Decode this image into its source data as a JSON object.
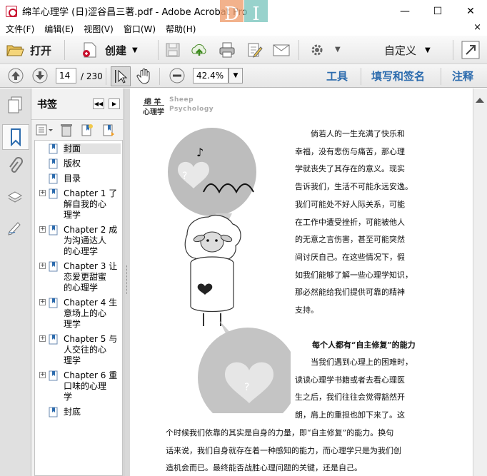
{
  "window": {
    "title": "绵羊心理学 (日)涩谷昌三著.pdf - Adobe Acrobat Pro",
    "logo_letters": [
      "D",
      "I"
    ],
    "controls": {
      "minimize": "—",
      "maximize": "☐",
      "close": "✕"
    }
  },
  "menu": {
    "items": [
      "文件(F)",
      "编辑(E)",
      "视图(V)",
      "窗口(W)",
      "帮助(H)"
    ],
    "close_doc": "×"
  },
  "toolbar": {
    "open_label": "打开",
    "create_label": "创建",
    "customize_label": "自定义"
  },
  "nav": {
    "current_page": "14",
    "page_total": "/ 230",
    "zoom": "42.4%",
    "tools_label": "工具",
    "fill_sign_label": "填写和签名",
    "comment_label": "注释"
  },
  "bookmarks": {
    "title": "书签",
    "items": [
      {
        "lines": [
          "封面"
        ],
        "expandable": false,
        "selected": true
      },
      {
        "lines": [
          "版权"
        ],
        "expandable": false,
        "selected": false
      },
      {
        "lines": [
          "目录"
        ],
        "expandable": false,
        "selected": false
      },
      {
        "lines": [
          "Chapter 1 了",
          "解自我的心",
          "理学"
        ],
        "expandable": true,
        "selected": false
      },
      {
        "lines": [
          "Chapter 2 成",
          "为沟通达人",
          "的心理学"
        ],
        "expandable": true,
        "selected": false
      },
      {
        "lines": [
          "Chapter 3 让",
          "恋爱更甜蜜",
          "的心理学"
        ],
        "expandable": true,
        "selected": false
      },
      {
        "lines": [
          "Chapter 4 生",
          "意场上的心",
          "理学"
        ],
        "expandable": true,
        "selected": false
      },
      {
        "lines": [
          "Chapter 5 与",
          "人交往的心",
          "理学"
        ],
        "expandable": true,
        "selected": false
      },
      {
        "lines": [
          "Chapter 6 重",
          "口味的心理",
          "学"
        ],
        "expandable": true,
        "selected": false
      },
      {
        "lines": [
          "封底"
        ],
        "expandable": false,
        "selected": false
      }
    ]
  },
  "page": {
    "header_cn_1": "绵 羊",
    "header_cn_2": "心理学",
    "header_en_1": "Sheep",
    "header_en_2": "Psychology",
    "para1_lines": [
      "倘若人的一生充满了快乐和",
      "幸福，没有悲伤与痛苦，那心理",
      "学就丧失了其存在的意义。现实",
      "告诉我们，生活不可能永远安逸。",
      "我们可能处不好人际关系，可能",
      "在工作中遭受挫折，可能被他人",
      "的无意之言伤害，甚至可能突然",
      "间讨厌自己。在这些情况下，假",
      "如我们能够了解一些心理学知识，",
      "那必然能给我们提供可靠的精神",
      "支持。"
    ],
    "heading": "每个人都有“自主修复”的能力",
    "para2_lines": [
      "当我们遇到心理上的困难时，",
      "读读心理学书籍或者去看心理医",
      "生之后，我们往往会觉得豁然开",
      "朗，肩上的重担也卸下来了。这"
    ],
    "para3_lines": [
      "个时候我们依靠的其实是自身的力量，即“自主修复”的能力。换句",
      "话来说，我们自身就存在着一种感知的能力，而心理学只是为我们创",
      "造机会而已。最终能否战胜心理问题的关键，还是自己。"
    ],
    "illustration_symbols": {
      "note": "♪",
      "question": "?"
    }
  },
  "colors": {
    "accent_blue": "#2d6cae",
    "pdf_red": "#c8102e"
  }
}
